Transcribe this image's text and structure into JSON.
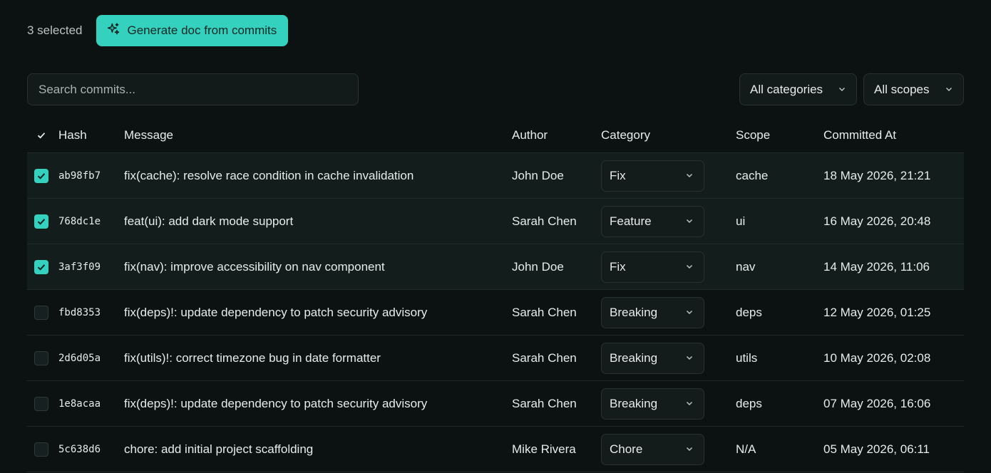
{
  "toolbar": {
    "selected_text": "3 selected",
    "generate_label": "Generate doc from commits",
    "accent": "#34d1be"
  },
  "search": {
    "placeholder": "Search commits..."
  },
  "filters": {
    "category": "All categories",
    "scope": "All scopes"
  },
  "table": {
    "headers": {
      "hash": "Hash",
      "message": "Message",
      "author": "Author",
      "category": "Category",
      "scope": "Scope",
      "committed_at": "Committed At"
    },
    "rows": [
      {
        "selected": true,
        "hash": "ab98fb7",
        "message": "fix(cache): resolve race condition in cache invalidation",
        "author": "John Doe",
        "category": "Fix",
        "scope": "cache",
        "committed_at": "18 May 2026, 21:21"
      },
      {
        "selected": true,
        "hash": "768dc1e",
        "message": "feat(ui): add dark mode support",
        "author": "Sarah Chen",
        "category": "Feature",
        "scope": "ui",
        "committed_at": "16 May 2026, 20:48"
      },
      {
        "selected": true,
        "hash": "3af3f09",
        "message": "fix(nav): improve accessibility on nav component",
        "author": "John Doe",
        "category": "Fix",
        "scope": "nav",
        "committed_at": "14 May 2026, 11:06"
      },
      {
        "selected": false,
        "hash": "fbd8353",
        "message": "fix(deps)!: update dependency to patch security advisory",
        "author": "Sarah Chen",
        "category": "Breaking",
        "scope": "deps",
        "committed_at": "12 May 2026, 01:25"
      },
      {
        "selected": false,
        "hash": "2d6d05a",
        "message": "fix(utils)!: correct timezone bug in date formatter",
        "author": "Sarah Chen",
        "category": "Breaking",
        "scope": "utils",
        "committed_at": "10 May 2026, 02:08"
      },
      {
        "selected": false,
        "hash": "1e8acaa",
        "message": "fix(deps)!: update dependency to patch security advisory",
        "author": "Sarah Chen",
        "category": "Breaking",
        "scope": "deps",
        "committed_at": "07 May 2026, 16:06"
      },
      {
        "selected": false,
        "hash": "5c638d6",
        "message": "chore: add initial project scaffolding",
        "author": "Mike Rivera",
        "category": "Chore",
        "scope": "N/A",
        "committed_at": "05 May 2026, 06:11"
      }
    ]
  }
}
